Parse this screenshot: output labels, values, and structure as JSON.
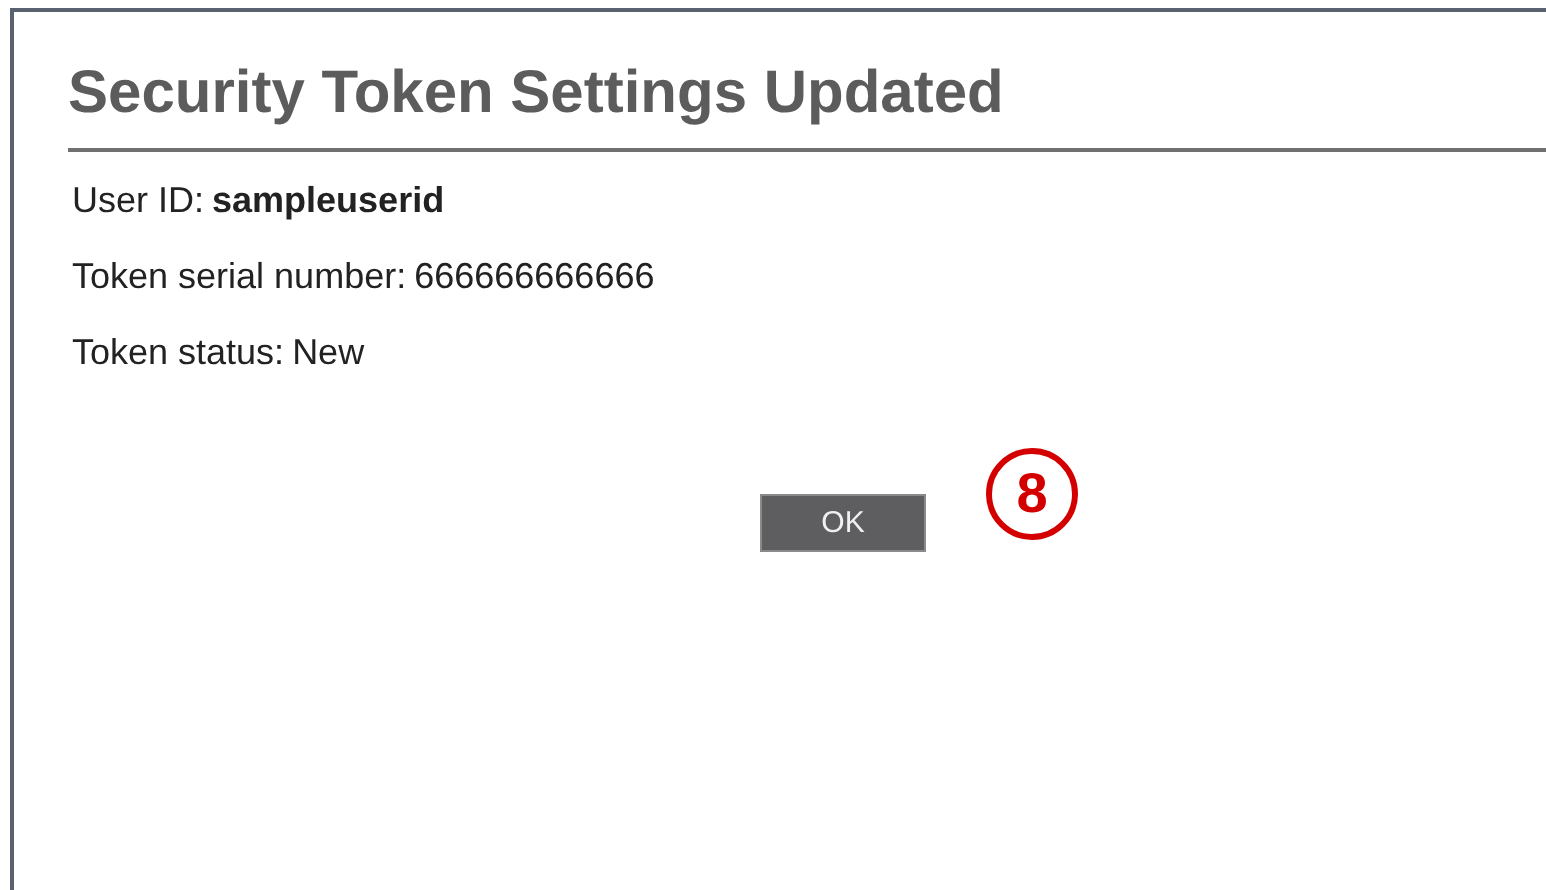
{
  "title": "Security Token Settings Updated",
  "fields": [
    {
      "label": "User ID:",
      "value": "sampleuserid",
      "kind": "bold"
    },
    {
      "label": "Token serial number:",
      "value": "666666666666",
      "kind": "plain"
    },
    {
      "label": "Token status:",
      "value": "New",
      "kind": "plain"
    }
  ],
  "button": "OK",
  "callout": "8"
}
